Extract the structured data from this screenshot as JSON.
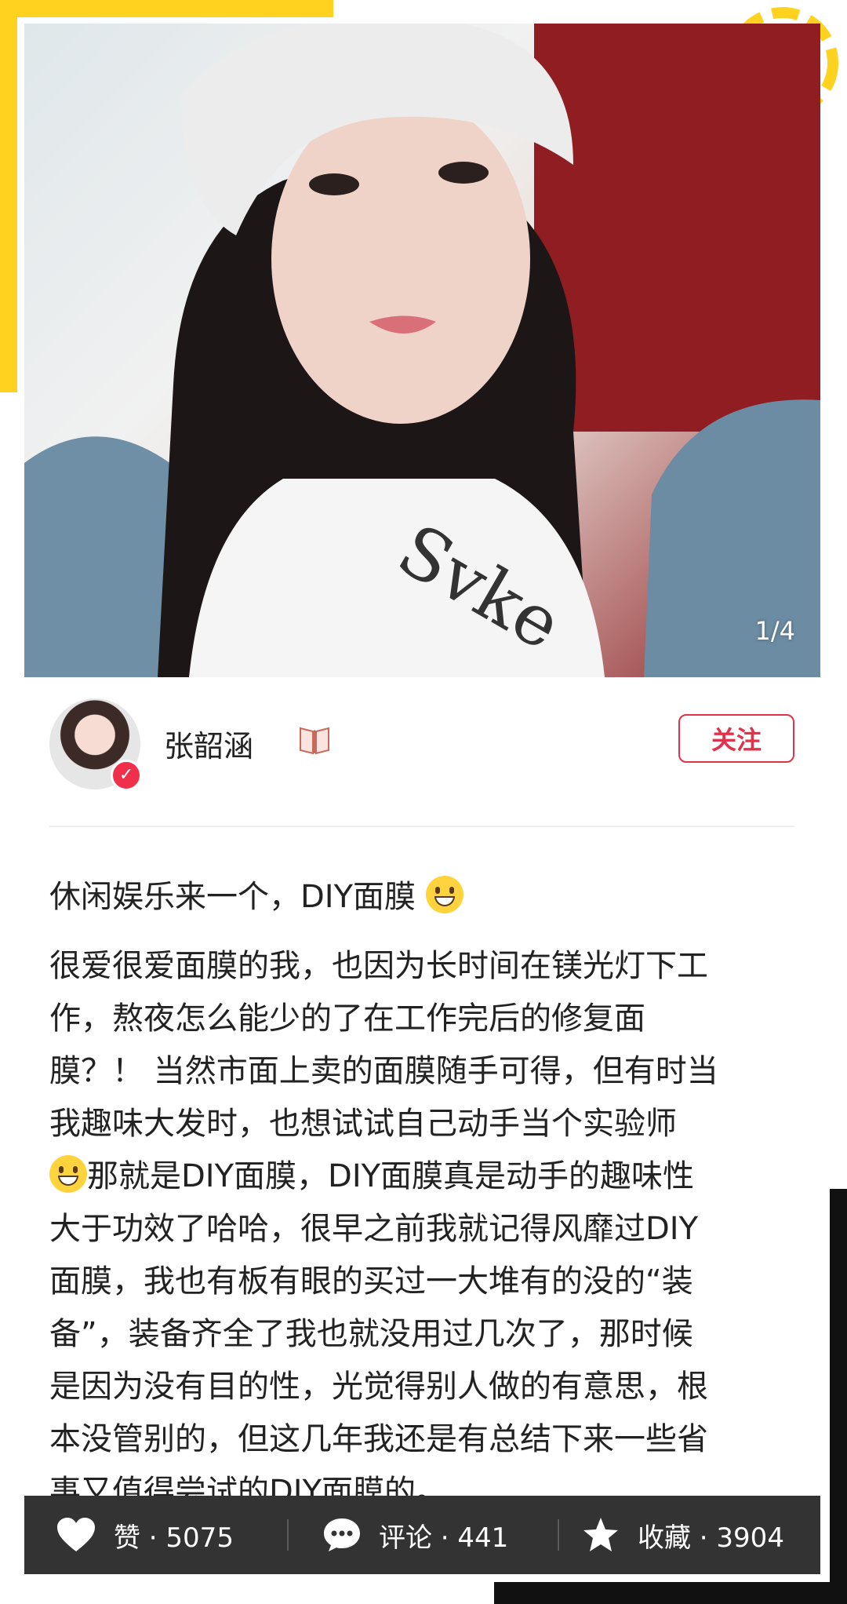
{
  "post": {
    "image_counter": "1/4",
    "author_name": "张韶涵",
    "follow_label": "关注",
    "title": "休闲娱乐来一个，DIY面膜",
    "body_lines": [
      "很爱很爱面膜的我，也因为长时间在镁光灯下工",
      "作，熬夜怎么能少的了在工作完后的修复面",
      "膜？！ 当然市面上卖的面膜随手可得，但有时当",
      "我趣味大发时，也想试试自己动手当个实验师",
      "那就是DIY面膜，DIY面膜真是动手的趣味性",
      "大于功效了哈哈，很早之前我就记得风靡过DIY",
      "面膜，我也有板有眼的买过一大堆有的没的“装",
      "备”，装备齐全了我也就没用过几次了，那时候",
      "是因为没有目的性，光觉得别人做的有意思，根",
      "本没管别的，但这几年我还是有总结下来一些省",
      "事又值得尝试的DIY面膜的。"
    ]
  },
  "actions": {
    "like_label": "赞 · 5075",
    "comment_label": "评论 · 441",
    "collect_label": "收藏 · 3904"
  },
  "icons": {
    "verified": "verified-badge-icon",
    "book": "book-icon",
    "title_emoji": "grinning-face-emoji-icon",
    "body_emoji": "sweat-smile-emoji-icon",
    "like": "heart-icon",
    "comment": "chat-bubble-icon",
    "collect": "star-icon"
  },
  "colors": {
    "accent_red": "#e0324b",
    "deco_yellow": "#ffd21f",
    "action_bar": "#333333"
  }
}
